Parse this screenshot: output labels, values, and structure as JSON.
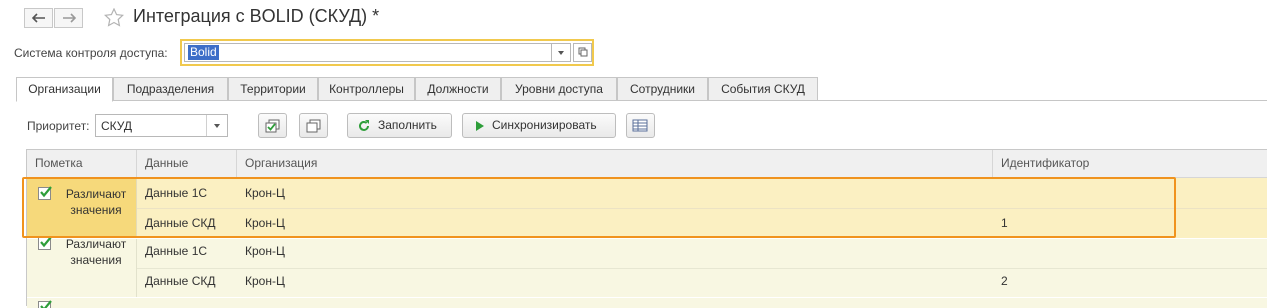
{
  "window": {
    "title": "Интеграция с BOLID (СКУД) *"
  },
  "access_system": {
    "label": "Система контроля доступа:",
    "value": "Bolid"
  },
  "tabs": [
    {
      "label": "Организации",
      "active": true
    },
    {
      "label": "Подразделения"
    },
    {
      "label": "Территории"
    },
    {
      "label": "Контроллеры"
    },
    {
      "label": "Должности"
    },
    {
      "label": "Уровни доступа"
    },
    {
      "label": "Сотрудники"
    },
    {
      "label": "События СКУД"
    }
  ],
  "toolbar": {
    "priority_label": "Приоритет:",
    "priority_value": "СКУД",
    "fill_label": "Заполнить",
    "sync_label": "Синхронизировать"
  },
  "table": {
    "columns": [
      "Пометка",
      "Данные",
      "Организация",
      "Идентификатор"
    ],
    "groups": [
      {
        "mark_checked": true,
        "mark_text": "Различают значения",
        "rows": [
          {
            "data": "Данные 1С",
            "organization": "Крон-Ц",
            "identifier": ""
          },
          {
            "data": "Данные СКД",
            "organization": "Крон-Ц",
            "identifier": "1"
          }
        ]
      },
      {
        "mark_checked": true,
        "mark_text": "Различают значения",
        "rows": [
          {
            "data": "Данные 1С",
            "organization": "Крон-Ц",
            "identifier": ""
          },
          {
            "data": "Данные СКД",
            "organization": "Крон-Ц",
            "identifier": "2"
          }
        ]
      }
    ]
  },
  "colors": {
    "selection_highlight": "#f0931e",
    "focus_border": "#f1c94d",
    "selected_row": "#fbf0c2",
    "checkbox_green": "#2e9e3a"
  }
}
